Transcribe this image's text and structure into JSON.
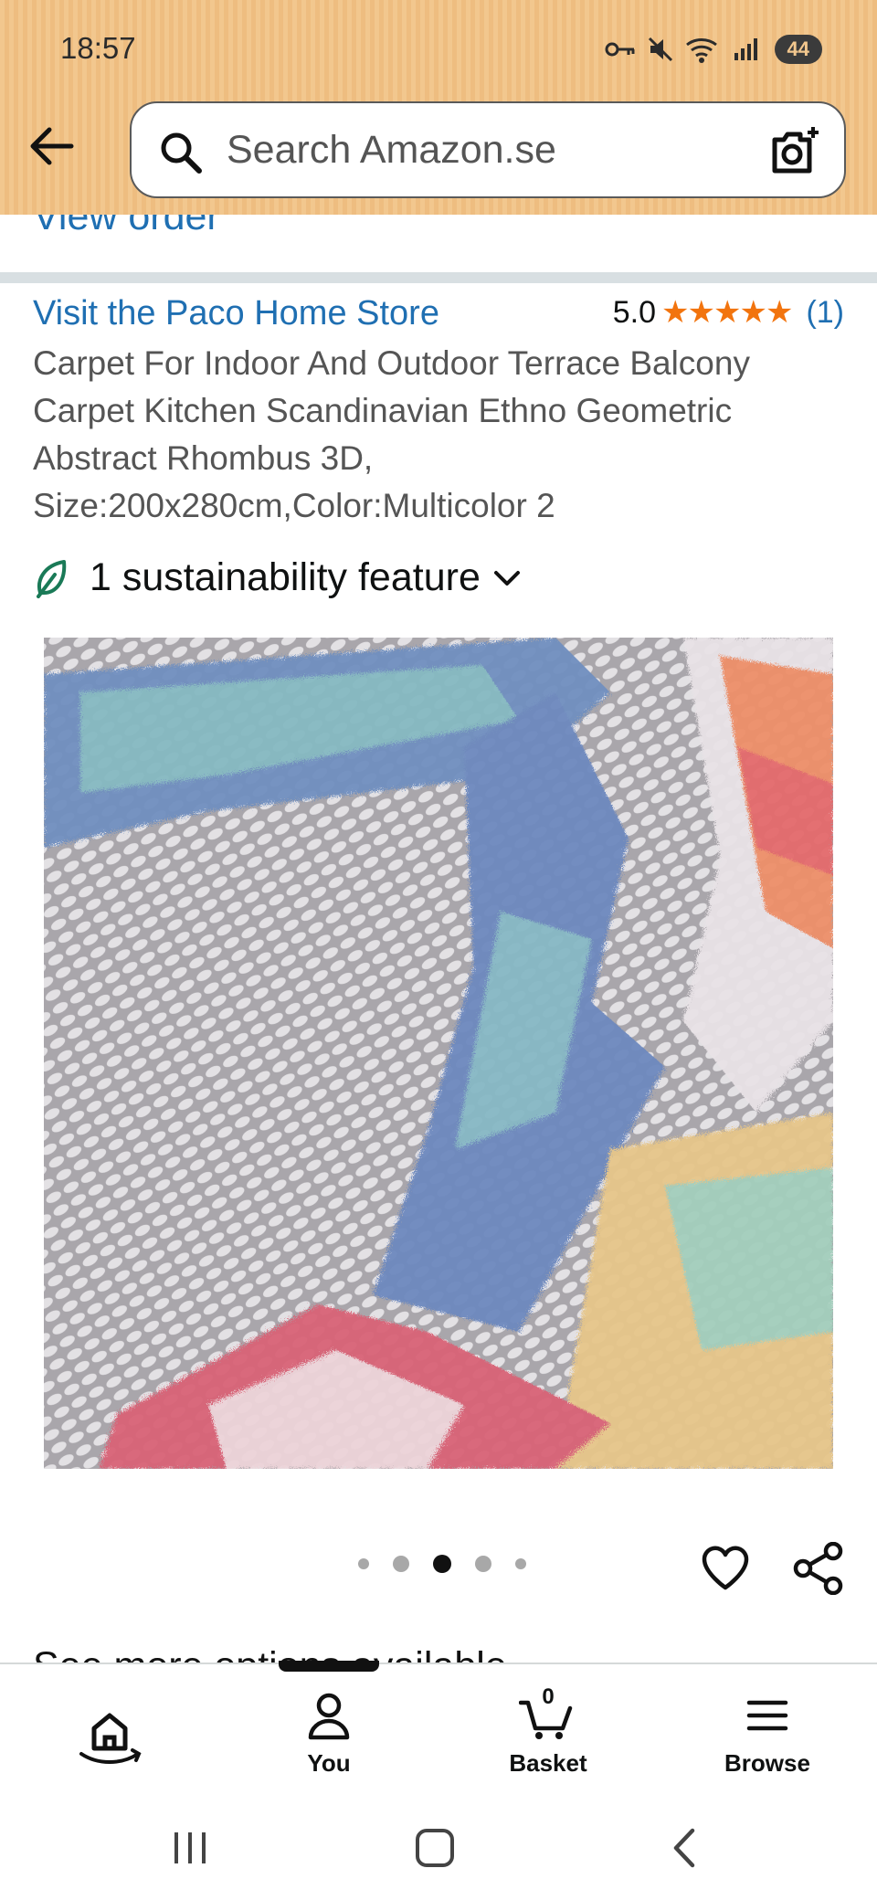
{
  "status_bar": {
    "time": "18:57",
    "battery": "44"
  },
  "search": {
    "placeholder": "Search Amazon.se"
  },
  "previous_section": {
    "view_order": "View order"
  },
  "product": {
    "store_link": "Visit the Paco Home Store",
    "rating_score": "5.0",
    "stars": "★★★★★",
    "rating_count": "(1)",
    "title": "Carpet For Indoor And Outdoor Terrace Balcony Carpet Kitchen Scandinavian Ethno Geometric Abstract Rhombus 3D, Size:200x280cm,Color:Multicolor 2",
    "sustainability": "1 sustainability feature",
    "image_count": 5,
    "active_image_index": 2
  },
  "next_section": {
    "heading_peek": "See more options available"
  },
  "bottom_nav": {
    "home_label": "",
    "you_label": "You",
    "basket_label": "Basket",
    "basket_count": "0",
    "browse_label": "Browse"
  },
  "colors": {
    "header": "#f2c78e",
    "link": "#1f6fb2",
    "star": "#f2740e"
  }
}
